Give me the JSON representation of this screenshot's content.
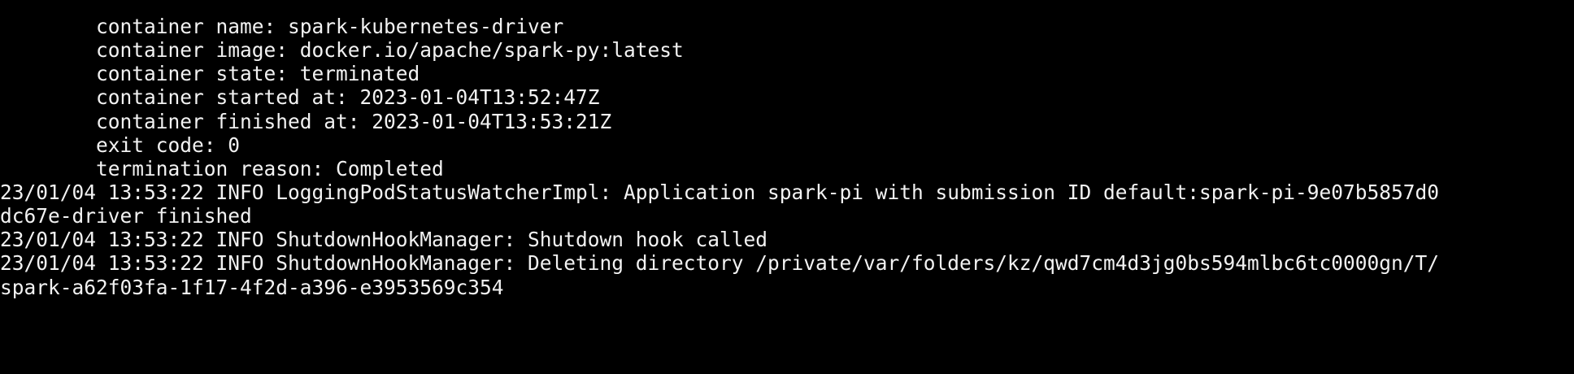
{
  "terminal": {
    "lines": [
      "        container name: spark-kubernetes-driver",
      "        container image: docker.io/apache/spark-py:latest",
      "        container state: terminated",
      "        container started at: 2023-01-04T13:52:47Z",
      "        container finished at: 2023-01-04T13:53:21Z",
      "        exit code: 0",
      "        termination reason: Completed",
      "23/01/04 13:53:22 INFO LoggingPodStatusWatcherImpl: Application spark-pi with submission ID default:spark-pi-9e07b5857d0",
      "dc67e-driver finished",
      "23/01/04 13:53:22 INFO ShutdownHookManager: Shutdown hook called",
      "23/01/04 13:53:22 INFO ShutdownHookManager: Deleting directory /private/var/folders/kz/qwd7cm4d3jg0bs594mlbc6tc0000gn/T/",
      "spark-a62f03fa-1f17-4f2d-a396-e3953569c354"
    ]
  },
  "colors": {
    "background": "#000000",
    "text": "#f2f2f2"
  }
}
